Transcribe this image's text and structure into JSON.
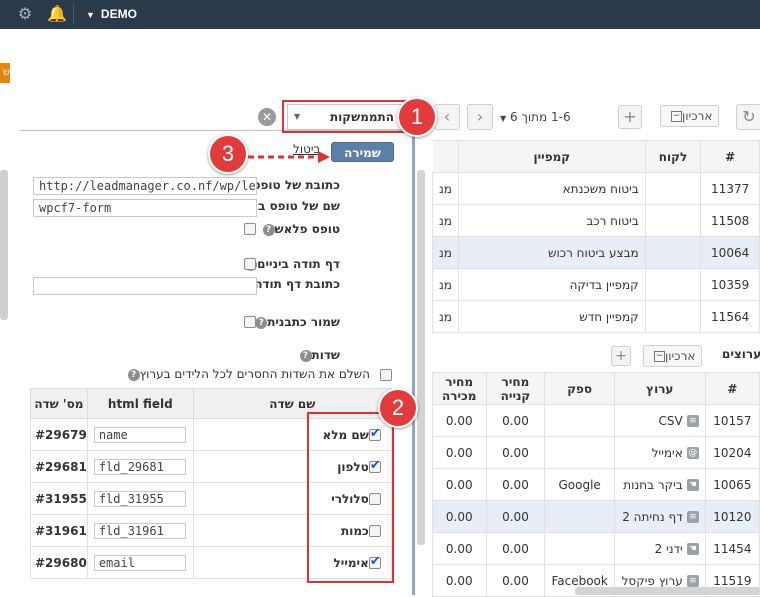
{
  "topbar": {
    "account": "DEMO",
    "settings_icon": "gear-icon",
    "notifications_icon": "bell-icon"
  },
  "orange_tab_label": "ש",
  "select": {
    "value": "התממשקות"
  },
  "save_label": "שמירה",
  "cancel_label": "ביטול",
  "form": {
    "form_url_label": "כתובת של טופס",
    "form_url_value": "http://leadmanager.co.nf/wp/leadm",
    "html_form_name_label": "שם של טופס ב HTML",
    "html_form_name_value": "wpcf7-form",
    "flash_form_label": "טופס פלאש",
    "thanks_page_label": "דף תודה ביניים",
    "thanks_url_label": "כתובת דף תודה",
    "save_template_label": "שמור כתבנית",
    "fields_label": "שדות",
    "complete_missing_label": "השלם את השדות החסרים לכל הלידים בערוץ"
  },
  "fields_table": {
    "headers": {
      "field_id": "מס' שדה",
      "html_field": "html field",
      "field_name": "שם שדה"
    },
    "rows": [
      {
        "id": "#29679",
        "html": "name",
        "name": "שם מלא",
        "checked": true
      },
      {
        "id": "#29681",
        "html": "fld_29681",
        "name": "טלפון",
        "checked": true
      },
      {
        "id": "#31955",
        "html": "fld_31955",
        "name": "סלולרי",
        "checked": false
      },
      {
        "id": "#31961",
        "html": "fld_31961",
        "name": "כמות",
        "checked": false
      },
      {
        "id": "#29680",
        "html": "email",
        "name": "אימייל",
        "checked": true
      }
    ]
  },
  "right_panel": {
    "pagination": "1-6 מתוך 6",
    "archive_label": "ארכיון",
    "campaigns_table": {
      "headers": {
        "id": "#",
        "customer": "לקוח",
        "campaign": "קמפיין"
      },
      "rows": [
        {
          "id": "11377",
          "campaign": "ביטוח משכנתא",
          "cut": "מנ"
        },
        {
          "id": "11508",
          "campaign": "ביטוח רכב",
          "cut": "מנ"
        },
        {
          "id": "10064",
          "campaign": "מבצע ביטוח רכוש",
          "cut": "מנ"
        },
        {
          "id": "10359",
          "campaign": "קמפיין בדיקה",
          "cut": "מנ"
        },
        {
          "id": "11564",
          "campaign": "קמפיין חדש",
          "cut": "מנ"
        }
      ]
    },
    "channels_title": "ערוצים",
    "channels_table": {
      "headers": {
        "id": "#",
        "channel": "ערוץ",
        "supplier": "ספק",
        "buy_price": "מחיר קנייה",
        "sell_price": "מחיר מכירה"
      },
      "rows": [
        {
          "id": "10157",
          "channel": "CSV",
          "supplier": "",
          "buy": "0.00",
          "sell": "0.00"
        },
        {
          "id": "10204",
          "channel": "אימייל",
          "supplier": "",
          "buy": "0.00",
          "sell": "0.00"
        },
        {
          "id": "10065",
          "channel": "ביקר בחנות",
          "supplier": "Google",
          "buy": "0.00",
          "sell": "0.00"
        },
        {
          "id": "10120",
          "channel": "דף נחיתה 2",
          "supplier": "",
          "buy": "0.00",
          "sell": "0.00"
        },
        {
          "id": "11454",
          "channel": "ידני 2",
          "supplier": "",
          "buy": "0.00",
          "sell": "0.00"
        },
        {
          "id": "11519",
          "channel": "ערוץ פיקסל",
          "supplier": "Facebook",
          "buy": "0.00",
          "sell": "0.00"
        }
      ]
    }
  },
  "annotations": {
    "marker_1": "1",
    "marker_2": "2",
    "marker_3": "3"
  }
}
